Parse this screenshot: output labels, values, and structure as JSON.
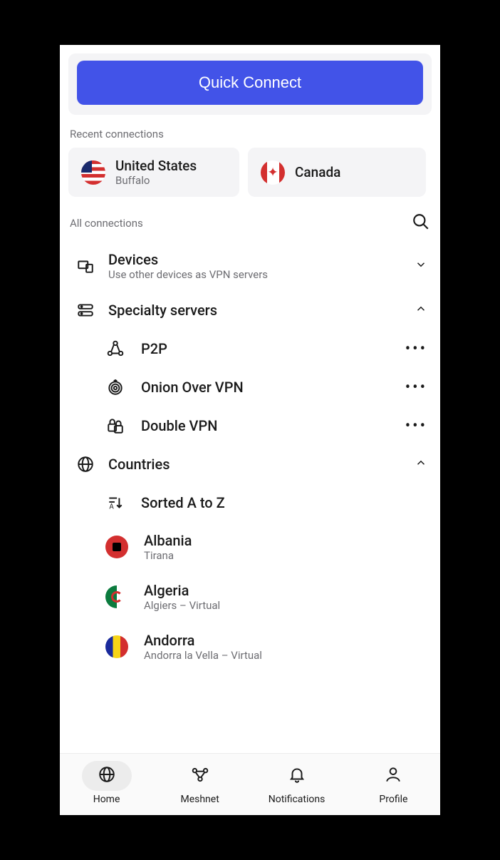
{
  "quickConnect": "Quick Connect",
  "recentLabel": "Recent connections",
  "recent": [
    {
      "country": "United States",
      "city": "Buffalo"
    },
    {
      "country": "Canada",
      "city": ""
    }
  ],
  "allConnLabel": "All connections",
  "devices": {
    "title": "Devices",
    "sub": "Use other devices as VPN servers"
  },
  "specialtyLabel": "Specialty servers",
  "specialty": [
    {
      "name": "P2P"
    },
    {
      "name": "Onion Over VPN"
    },
    {
      "name": "Double VPN"
    }
  ],
  "countriesLabel": "Countries",
  "sortLabel": "Sorted A to Z",
  "countries": [
    {
      "name": "Albania",
      "city": "Tirana"
    },
    {
      "name": "Algeria",
      "city": "Algiers – Virtual"
    },
    {
      "name": "Andorra",
      "city": "Andorra la Vella – Virtual"
    }
  ],
  "nav": {
    "home": "Home",
    "meshnet": "Meshnet",
    "notifications": "Notifications",
    "profile": "Profile"
  }
}
